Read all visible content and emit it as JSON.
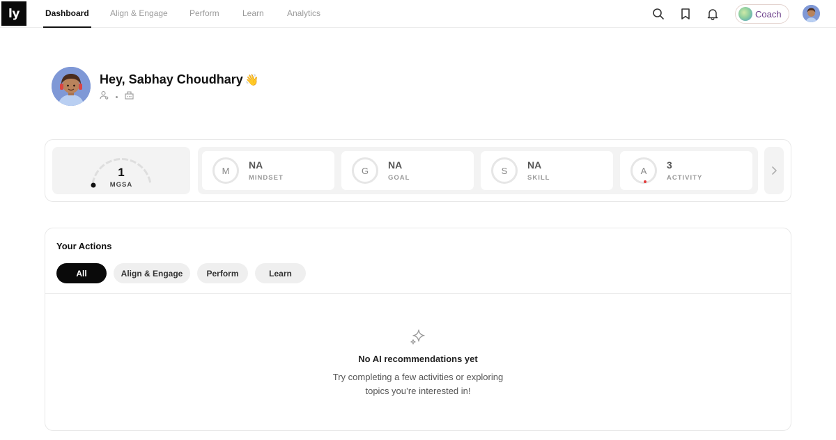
{
  "nav": {
    "logo": "ly",
    "tabs": [
      {
        "label": "Dashboard",
        "active": true
      },
      {
        "label": "Align & Engage",
        "active": false
      },
      {
        "label": "Perform",
        "active": false
      },
      {
        "label": "Learn",
        "active": false
      },
      {
        "label": "Analytics",
        "active": false
      }
    ],
    "icons": [
      "search-icon",
      "bookmark-icon",
      "bell-icon"
    ],
    "coach_label": "Coach"
  },
  "profile": {
    "greeting": "Hey, Sabhay Choudhary",
    "wave": "👋",
    "meta_icons": [
      "person-badge-icon",
      "building-icon"
    ]
  },
  "scores": {
    "mgsa": {
      "value": "1",
      "label": "MGSA"
    },
    "metrics": [
      {
        "letter": "M",
        "value": "NA",
        "label": "MINDSET"
      },
      {
        "letter": "G",
        "value": "NA",
        "label": "GOAL"
      },
      {
        "letter": "S",
        "value": "NA",
        "label": "SKILL"
      },
      {
        "letter": "A",
        "value": "3",
        "label": "ACTIVITY"
      }
    ]
  },
  "actions": {
    "title": "Your Actions",
    "filters": [
      {
        "label": "All",
        "active": true
      },
      {
        "label": "Align & Engage",
        "active": false
      },
      {
        "label": "Perform",
        "active": false
      },
      {
        "label": "Learn",
        "active": false
      }
    ],
    "empty_title": "No AI recommendations yet",
    "empty_line1": "Try completing a few activities or exploring",
    "empty_line2": "topics you’re interested in!"
  },
  "colors": {
    "accent": "#0a0a0a",
    "muted": "#9a9a9a",
    "coach_text": "#6b3e8a",
    "activity_dot": "#e23b3b"
  }
}
